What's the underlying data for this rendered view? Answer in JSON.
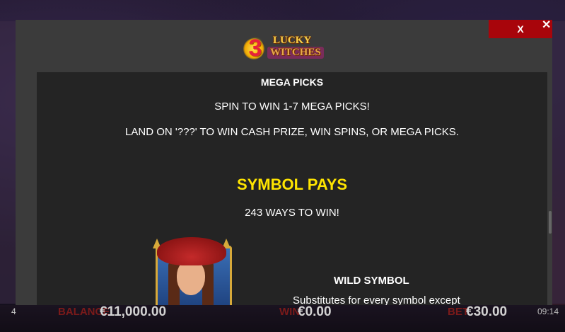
{
  "logo": {
    "number": "3",
    "word_top": "LUCKY",
    "word_bottom": "WITCHES"
  },
  "close": {
    "button_label": "X",
    "corner_label": "✕"
  },
  "content": {
    "mega_picks_title": "MEGA PICKS",
    "mega_picks_line1": "SPIN TO WIN 1-7 MEGA PICKS!",
    "mega_picks_line2": "LAND ON '???' TO WIN CASH PRIZE, WIN SPINS, OR MEGA PICKS.",
    "symbol_pays_title": "SYMBOL PAYS",
    "ways_text": "243 WAYS TO WIN!",
    "wild_title": "WILD SYMBOL",
    "wild_desc": "Substitutes for every symbol except"
  },
  "colors": {
    "accent_yellow": "#ffe500",
    "close_red": "#a8050b"
  },
  "bottom_bar": {
    "icon": "4",
    "balance_label": "BALANCE",
    "balance_value": "€11,000.00",
    "win_label": "WIN",
    "win_value": "€0.00",
    "bet_label": "BET",
    "bet_value": "€30.00",
    "time": "09:14"
  },
  "icons": [
    "close-icon",
    "witch-wild-symbol-icon",
    "sound-icon"
  ]
}
